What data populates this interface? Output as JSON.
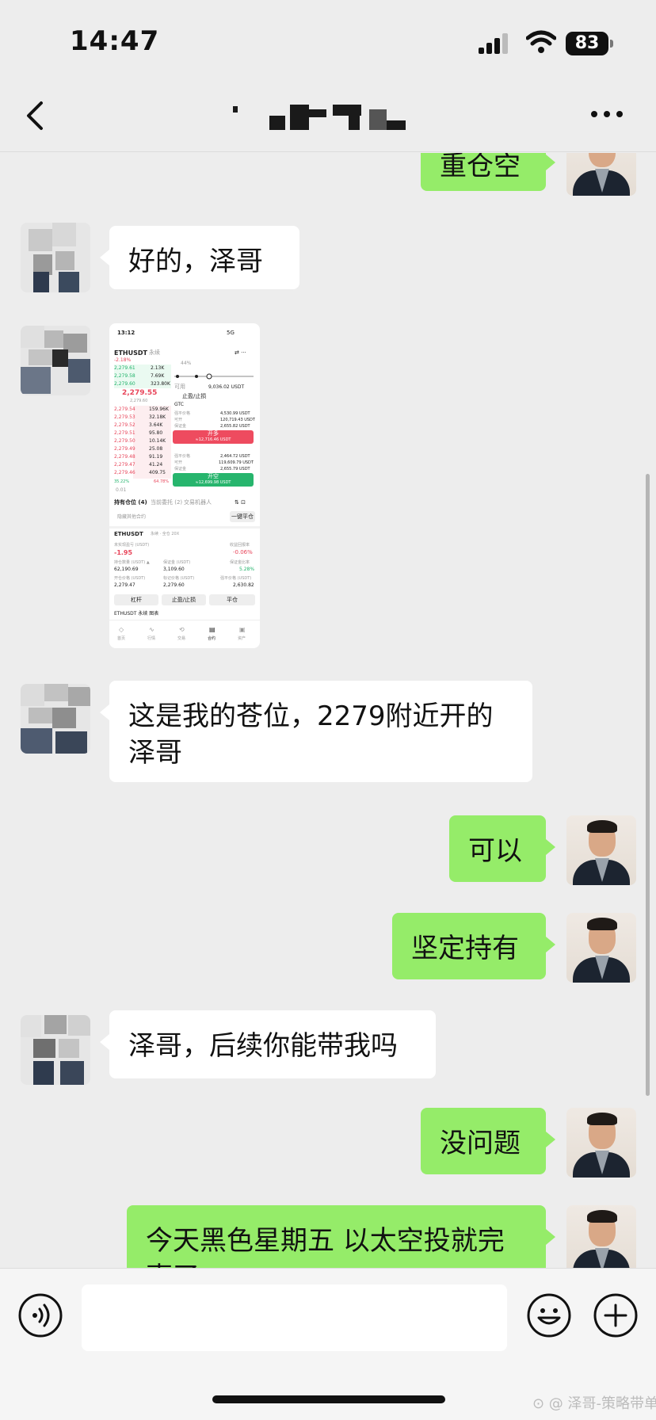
{
  "status_bar": {
    "time": "14:47",
    "battery": "83"
  },
  "nav": {
    "title": "（名称已打码）"
  },
  "messages": [
    {
      "side": "out",
      "text": "重仓空"
    },
    {
      "side": "in",
      "text": "好的，泽哥"
    },
    {
      "side": "in",
      "type": "image"
    },
    {
      "side": "in",
      "text": "这是我的苍位，2279附近开的泽哥"
    },
    {
      "side": "out",
      "text": "可以"
    },
    {
      "side": "out",
      "text": "坚定持有"
    },
    {
      "side": "in",
      "text": "泽哥，后续你能带我吗"
    },
    {
      "side": "out",
      "text": "没问题"
    },
    {
      "side": "out",
      "text": "今天黑色星期五 以太空投就完事了"
    }
  ],
  "shared_screenshot": {
    "time": "13:12",
    "network": "5G",
    "pair": "ETHUSDT",
    "contract": "永续",
    "change": "-2.18%",
    "asks": [
      {
        "price": "2,279.61",
        "qty": "2.13K"
      },
      {
        "price": "2,279.58",
        "qty": "7.69K"
      },
      {
        "price": "2,279.60",
        "qty": "323.80K"
      }
    ],
    "mid_price": "2,279.55",
    "mid_sub": "2,279.60",
    "bids": [
      {
        "price": "2,279.54",
        "qty": "159.96K"
      },
      {
        "price": "2,279.53",
        "qty": "32.18K"
      },
      {
        "price": "2,279.52",
        "qty": "3.64K"
      },
      {
        "price": "2,279.51",
        "qty": "95.80"
      },
      {
        "price": "2,279.50",
        "qty": "10.14K"
      },
      {
        "price": "2,279.49",
        "qty": "25.08"
      },
      {
        "price": "2,279.48",
        "qty": "91.19"
      },
      {
        "price": "2,279.47",
        "qty": "41.24"
      },
      {
        "price": "2,279.46",
        "qty": "409.75"
      }
    ],
    "ratio_left": "35.22%",
    "ratio_right": "64.78%",
    "depth_label": "0.01",
    "slider_pct": "44%",
    "available_label": "可用",
    "available_value": "9,036.02 USDT",
    "tpsl_label": "止盈/止损",
    "gtc": "GTC",
    "buy_rows": [
      {
        "k": "强平价格",
        "v": "4,530.99 USDT"
      },
      {
        "k": "可开",
        "v": "120,719.43 USDT"
      },
      {
        "k": "保证金",
        "v": "2,655.82 USDT"
      }
    ],
    "buy_btn": "开多",
    "buy_sub": "≈12,716.46 USDT",
    "sell_rows": [
      {
        "k": "强平价格",
        "v": "2,464.72 USDT"
      },
      {
        "k": "可开",
        "v": "119,609.79 USDT"
      },
      {
        "k": "保证金",
        "v": "2,655.79 USDT"
      }
    ],
    "sell_btn": "开空",
    "sell_sub": "≈12,699.98 USDT",
    "tabs": [
      "持有仓位 (4)",
      "当前委托 (2)",
      "交易机器人"
    ],
    "hide_other": "隐藏其他合约",
    "close_all": "一键平仓",
    "position_pair": "ETHUSDT",
    "position_tag": "永续 · 全仓 20X",
    "pnl_label": "未实现盈亏 (USDT)",
    "pnl_value": "-1.95",
    "roi_label": "收益回报率",
    "roi_value": "-0.06%",
    "size_label": "持仓数量 (USDT) ▲",
    "size_value": "62,190.69",
    "margin_label": "保证金 (USDT)",
    "margin_value": "3,109.60",
    "margin_ratio_label": "保证金比率",
    "margin_ratio_value": "5.28%",
    "entry_label": "开仓价格 (USDT)",
    "entry_value": "2,279.47",
    "mark_label": "标记价格 (USDT)",
    "mark_value": "2,279.60",
    "liq_label": "强平价格 (USDT)",
    "liq_value": "2,630.82",
    "actions": [
      "杠杆",
      "止盈/止损",
      "平仓"
    ],
    "footer_line": "ETHUSDT 永续 图表",
    "bottom_nav": [
      "首页",
      "行情",
      "交易",
      "合约",
      "资产"
    ]
  },
  "input_bar": {
    "placeholder": ""
  },
  "watermark": "⊙ @ 泽哥-策略带单",
  "colors": {
    "bubble_out": "#95ec69",
    "bubble_in": "#ffffff",
    "background": "#ededed"
  }
}
